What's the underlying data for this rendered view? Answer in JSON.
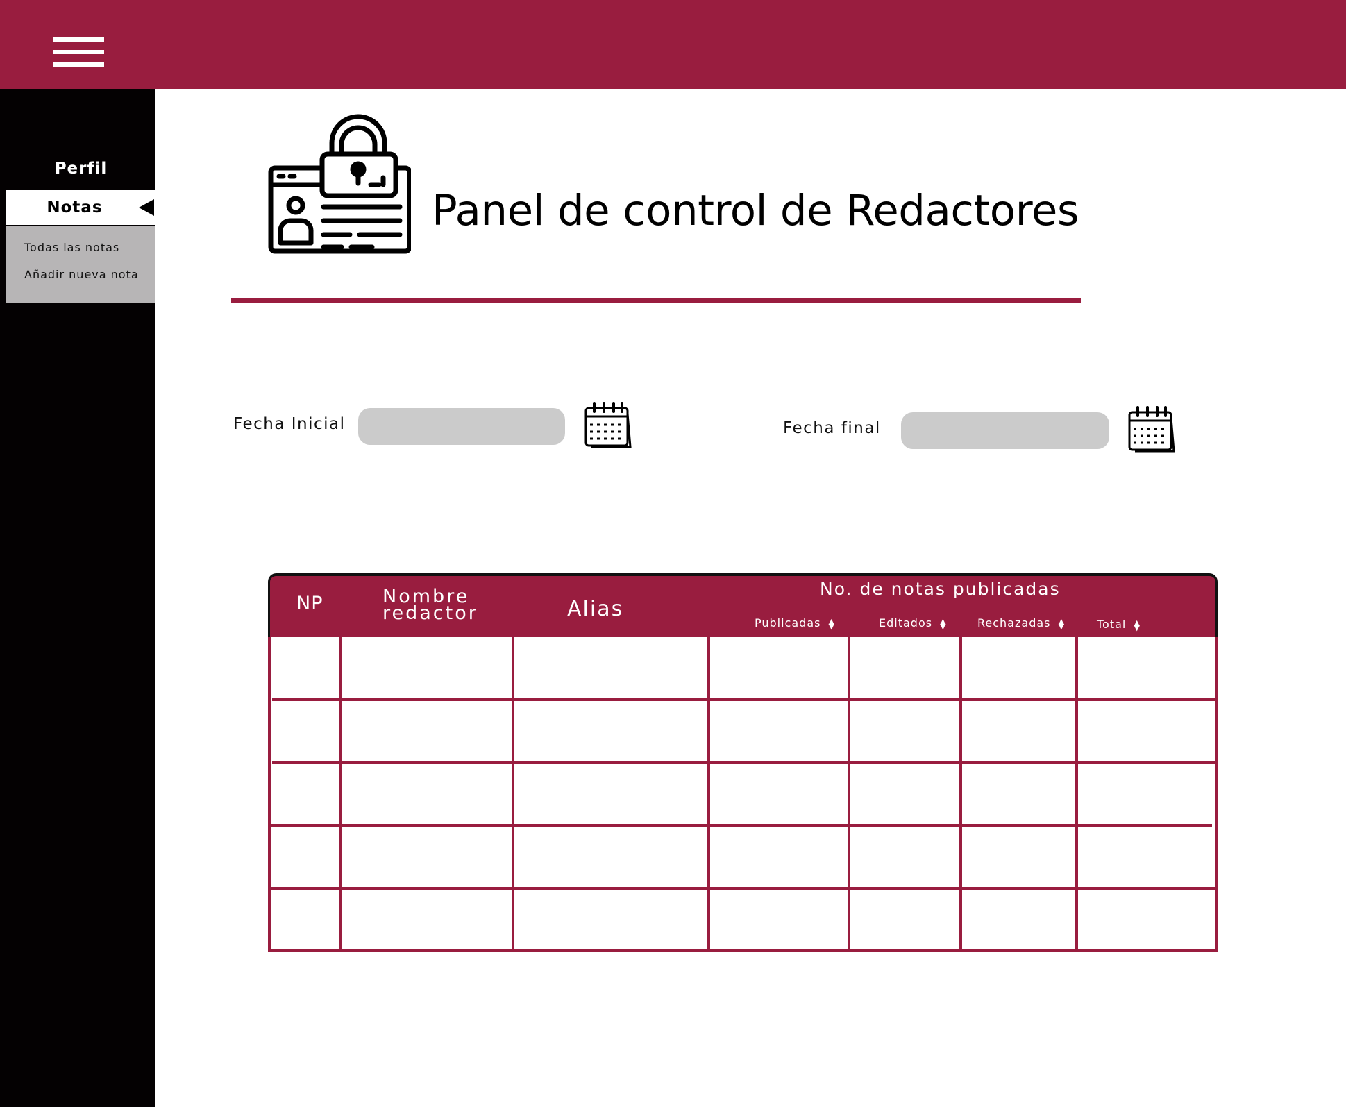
{
  "header": {
    "menu_icon": "hamburger-icon",
    "accent_color": "#991d3f"
  },
  "sidebar": {
    "items": [
      {
        "label": "Perfil"
      },
      {
        "label": "Notas",
        "active": true
      }
    ],
    "submenu": [
      {
        "label": "Todas las notas"
      },
      {
        "label": "Añadir nueva nota"
      }
    ]
  },
  "main": {
    "title": "Panel de control de Redactores",
    "title_icon": "id-card-lock-icon",
    "filters": {
      "start_label": "Fecha Inicial",
      "start_value": "",
      "end_label": "Fecha final",
      "end_value": "",
      "calendar_icon": "calendar-icon"
    },
    "table": {
      "columns": {
        "np": "NP",
        "nombre_line1": "Nombre",
        "nombre_line2": "redactor",
        "alias": "Alias",
        "group": "No. de notas publicadas",
        "publicadas": "Publicadas",
        "editados": "Editados",
        "rechazadas": "Rechazadas",
        "total": "Total"
      },
      "rows": [
        [
          "",
          "",
          "",
          "",
          "",
          "",
          ""
        ],
        [
          "",
          "",
          "",
          "",
          "",
          "",
          ""
        ],
        [
          "",
          "",
          "",
          "",
          "",
          "",
          ""
        ],
        [
          "",
          "",
          "",
          "",
          "",
          "",
          ""
        ],
        [
          "",
          "",
          "",
          "",
          "",
          "",
          ""
        ]
      ]
    }
  }
}
